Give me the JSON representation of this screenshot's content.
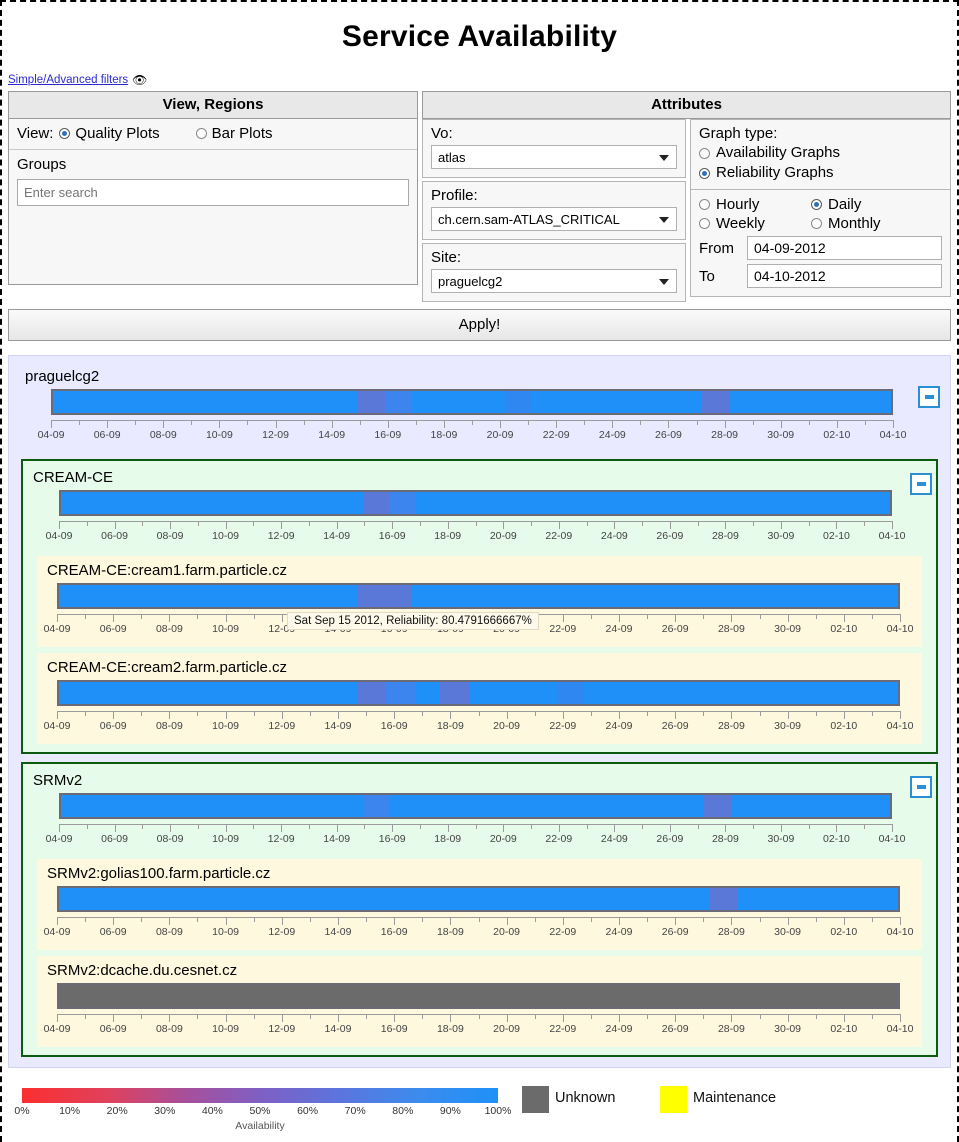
{
  "page": {
    "title": "Service Availability",
    "filters_link": "Simple/Advanced filters",
    "eye_icon": "eye-icon"
  },
  "headers": {
    "left": "View, Regions",
    "right": "Attributes"
  },
  "view": {
    "label": "View:",
    "options": [
      {
        "label": "Quality Plots",
        "selected": true
      },
      {
        "label": "Bar Plots",
        "selected": false
      }
    ],
    "groups_title": "Groups",
    "search_placeholder": "Enter search",
    "search_value": ""
  },
  "attributes": {
    "vo": {
      "label": "Vo:",
      "value": "atlas"
    },
    "profile": {
      "label": "Profile:",
      "value": "ch.cern.sam-ATLAS_CRITICAL"
    },
    "site": {
      "label": "Site:",
      "value": "praguelcg2"
    }
  },
  "graph_type": {
    "label": "Graph type:",
    "options": [
      {
        "label": "Availability Graphs",
        "selected": false
      },
      {
        "label": "Reliability Graphs",
        "selected": true
      }
    ],
    "periods": [
      {
        "label": "Hourly",
        "selected": false
      },
      {
        "label": "Daily",
        "selected": true
      },
      {
        "label": "Weekly",
        "selected": false
      },
      {
        "label": "Monthly",
        "selected": false
      }
    ],
    "from_label": "From",
    "from_value": "04-09-2012",
    "to_label": "To",
    "to_value": "04-10-2012"
  },
  "apply_label": "Apply!",
  "tooltip": "Sat Sep 15 2012, Reliability: 80.4791666667%",
  "collapse_label": "−",
  "legend": {
    "ticks": [
      "0%",
      "10%",
      "20%",
      "30%",
      "40%",
      "50%",
      "60%",
      "70%",
      "80%",
      "90%",
      "100%"
    ],
    "caption": "Availability",
    "unknown": "Unknown",
    "maintenance": "Maintenance",
    "unknown_color": "#6b6b6b",
    "maintenance_color": "#ffff00"
  },
  "chart_data": {
    "type": "heatmap",
    "title": "Service Availability",
    "xlabel": "",
    "ylabel": "Reliability",
    "metric": "Reliability",
    "period": "Daily",
    "date_range": {
      "from": "04-09-2012",
      "to": "04-10-2012"
    },
    "axis_ticks": [
      "04-09",
      "06-09",
      "08-09",
      "10-09",
      "12-09",
      "14-09",
      "16-09",
      "18-09",
      "20-09",
      "22-09",
      "24-09",
      "26-09",
      "28-09",
      "30-09",
      "02-10",
      "04-10"
    ],
    "colors": {
      "full": "#1e90f8",
      "reduced": "#5a78d8",
      "reduced_light": "#3d85ee",
      "unknown": "#6b6b6b",
      "maintenance": "#ffff00"
    },
    "rows": [
      {
        "name": "praguelcg2",
        "level": "site",
        "segments": [
          {
            "start": 0,
            "end": 36.4,
            "color": "#1e90f8"
          },
          {
            "start": 36.4,
            "end": 39.6,
            "color": "#5a78d8"
          },
          {
            "start": 39.6,
            "end": 42.8,
            "color": "#3d85ee"
          },
          {
            "start": 42.8,
            "end": 54.0,
            "color": "#1e90f8"
          },
          {
            "start": 54.0,
            "end": 57.2,
            "color": "#2f87f2"
          },
          {
            "start": 57.2,
            "end": 77.5,
            "color": "#1e90f8"
          },
          {
            "start": 77.5,
            "end": 80.8,
            "color": "#5a78d8"
          },
          {
            "start": 80.8,
            "end": 100,
            "color": "#1e90f8"
          }
        ]
      },
      {
        "name": "CREAM-CE",
        "level": "service",
        "segments": [
          {
            "start": 0,
            "end": 36.4,
            "color": "#1e90f8"
          },
          {
            "start": 36.4,
            "end": 39.6,
            "color": "#5a78d8"
          },
          {
            "start": 39.6,
            "end": 42.8,
            "color": "#3d85ee"
          },
          {
            "start": 42.8,
            "end": 100,
            "color": "#1e90f8"
          }
        ]
      },
      {
        "name": "CREAM-CE:cream1.farm.particle.cz",
        "level": "endpoint",
        "segments": [
          {
            "start": 0,
            "end": 35.5,
            "color": "#1e90f8"
          },
          {
            "start": 35.5,
            "end": 42.0,
            "color": "#5a78d8"
          },
          {
            "start": 42.0,
            "end": 100,
            "color": "#1e90f8"
          }
        ]
      },
      {
        "name": "CREAM-CE:cream2.farm.particle.cz",
        "level": "endpoint",
        "segments": [
          {
            "start": 0,
            "end": 35.5,
            "color": "#1e90f8"
          },
          {
            "start": 35.5,
            "end": 39.0,
            "color": "#5a78d8"
          },
          {
            "start": 39.0,
            "end": 42.5,
            "color": "#3d85ee"
          },
          {
            "start": 42.5,
            "end": 45.3,
            "color": "#1e90f8"
          },
          {
            "start": 45.3,
            "end": 49.0,
            "color": "#5a78d8"
          },
          {
            "start": 49.0,
            "end": 59.5,
            "color": "#1e90f8"
          },
          {
            "start": 59.5,
            "end": 62.5,
            "color": "#2f87f2"
          },
          {
            "start": 62.5,
            "end": 100,
            "color": "#1e90f8"
          }
        ]
      },
      {
        "name": "SRMv2",
        "level": "service",
        "segments": [
          {
            "start": 0,
            "end": 36.4,
            "color": "#1e90f8"
          },
          {
            "start": 36.4,
            "end": 39.6,
            "color": "#3d85ee"
          },
          {
            "start": 39.6,
            "end": 77.5,
            "color": "#1e90f8"
          },
          {
            "start": 77.5,
            "end": 80.8,
            "color": "#5a78d8"
          },
          {
            "start": 80.8,
            "end": 100,
            "color": "#1e90f8"
          }
        ]
      },
      {
        "name": "SRMv2:golias100.farm.particle.cz",
        "level": "endpoint",
        "segments": [
          {
            "start": 0,
            "end": 77.5,
            "color": "#1e90f8"
          },
          {
            "start": 77.5,
            "end": 80.8,
            "color": "#5a78d8"
          },
          {
            "start": 80.8,
            "end": 100,
            "color": "#1e90f8"
          }
        ]
      },
      {
        "name": "SRMv2:dcache.du.cesnet.cz",
        "level": "endpoint",
        "segments": [
          {
            "start": 0,
            "end": 100,
            "color": "#6b6b6b"
          }
        ]
      }
    ]
  }
}
